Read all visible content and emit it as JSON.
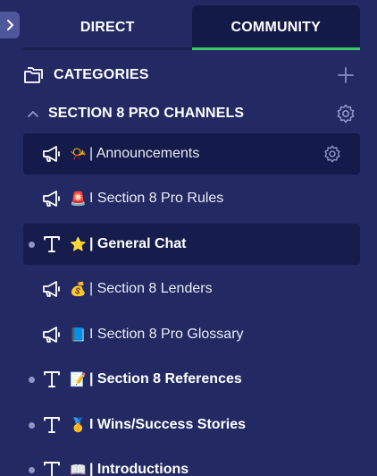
{
  "tabs": [
    {
      "label": "DIRECT",
      "active": false
    },
    {
      "label": "COMMUNITY",
      "active": true
    }
  ],
  "categories": {
    "label": "CATEGORIES"
  },
  "section": {
    "label": "SECTION 8 PRO CHANNELS",
    "expanded": true
  },
  "channels": [
    {
      "icon": "megaphone-icon",
      "emoji": "📯",
      "name": "| Announcements",
      "selected": true,
      "unread": false,
      "show_settings": true
    },
    {
      "icon": "megaphone-icon",
      "emoji": "🚨",
      "name": "I Section 8 Pro Rules",
      "selected": false,
      "unread": false
    },
    {
      "icon": "text-channel-icon",
      "emoji": "⭐",
      "name": "| General Chat",
      "selected": false,
      "unread": true
    },
    {
      "icon": "megaphone-icon",
      "emoji": "💰",
      "name": "| Section 8 Lenders",
      "selected": false,
      "unread": false
    },
    {
      "icon": "megaphone-icon",
      "emoji": "📘",
      "name": "I Section 8 Pro Glossary",
      "selected": false,
      "unread": false
    },
    {
      "icon": "text-channel-icon",
      "emoji": "📝",
      "name": "| Section 8 References",
      "selected": false,
      "unread": true
    },
    {
      "icon": "text-channel-icon",
      "emoji": "🥇",
      "name": "I Wins/Success Stories",
      "selected": false,
      "unread": true
    },
    {
      "icon": "text-channel-icon",
      "emoji": "📖",
      "name": "| Introductions",
      "selected": false,
      "unread": true
    }
  ],
  "colors": {
    "background": "#232a63",
    "active_tab_bg": "#131a48",
    "active_tab_underline": "#3ec86b",
    "selected_row_bg": "#141a49",
    "unread_dot": "#8f96c6"
  }
}
